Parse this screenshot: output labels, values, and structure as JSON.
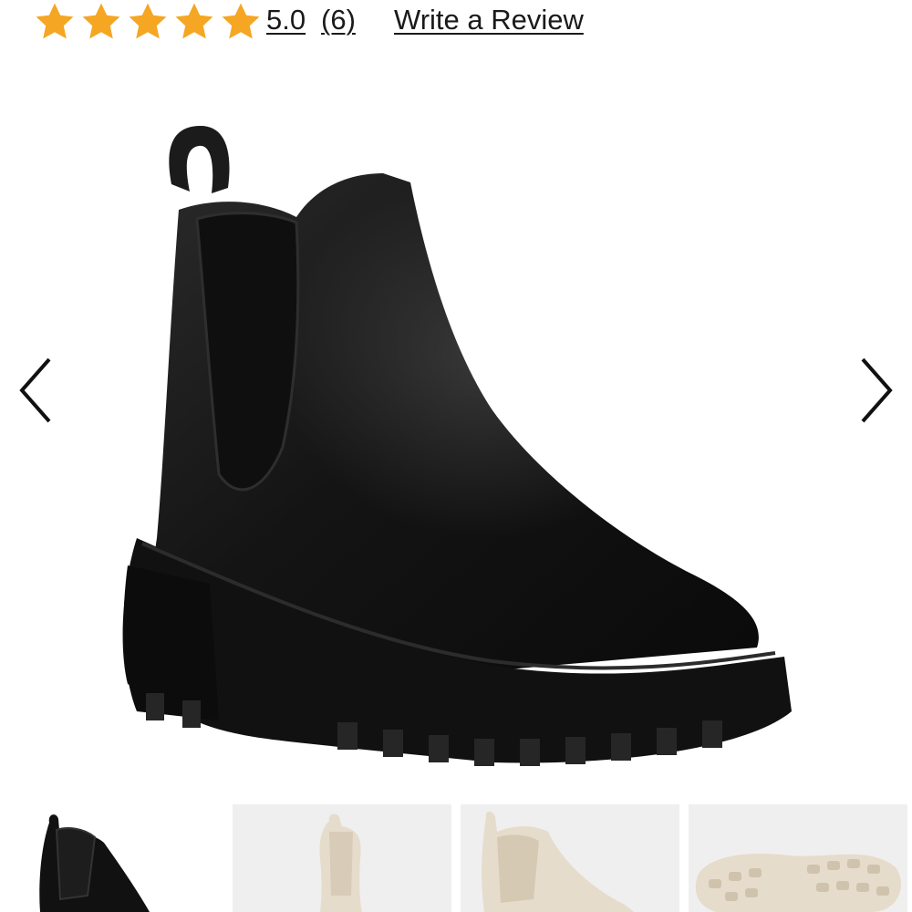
{
  "rating": {
    "value": "5.0",
    "count": "(6)",
    "stars_filled": 5,
    "stars_total": 5,
    "star_color": "#F5A623",
    "write_review_label": "Write a Review"
  },
  "gallery": {
    "prev_icon": "chevron-left-icon",
    "next_icon": "chevron-right-icon",
    "main_image_subject": "black leather chelsea boot with lug sole",
    "thumbnails": [
      {
        "subject": "black chelsea boot side view",
        "selected": true
      },
      {
        "subject": "cream chelsea boot front view",
        "selected": false
      },
      {
        "subject": "cream chelsea boot side view",
        "selected": false
      },
      {
        "subject": "cream lug sole bottom view",
        "selected": false
      }
    ]
  },
  "colors": {
    "text": "#1A1A1A",
    "boot": "#141414",
    "thumb_background": "#EFEFEF",
    "cream_boot": "#E6DCCB"
  }
}
